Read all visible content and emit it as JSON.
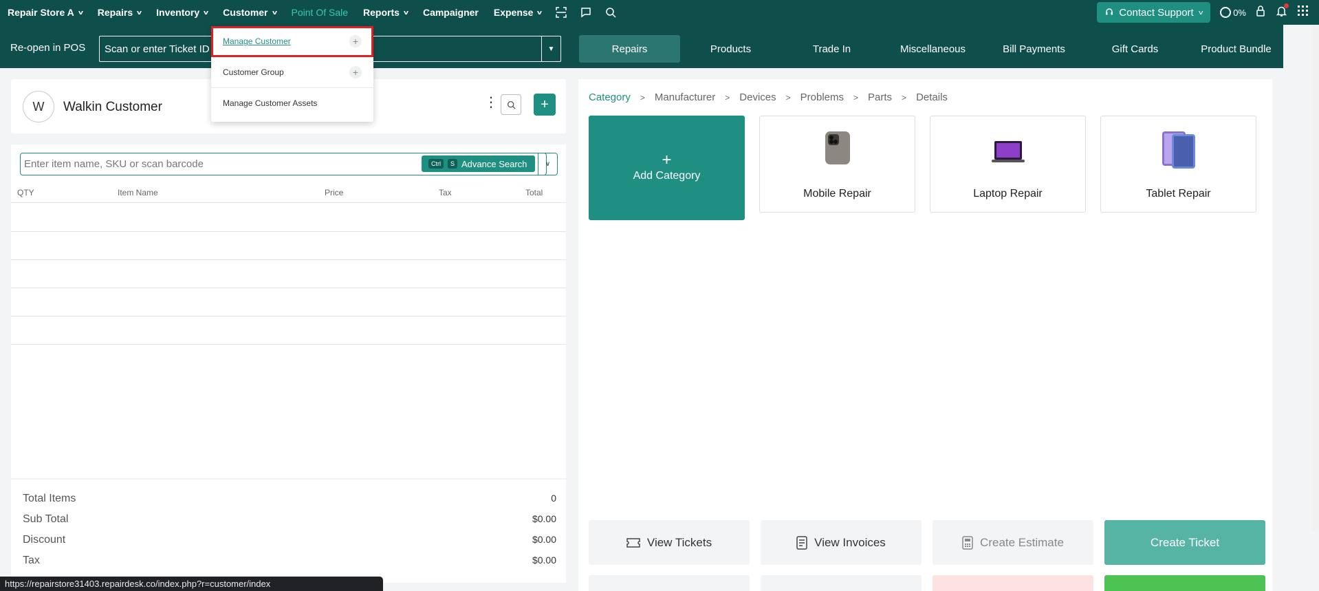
{
  "topnav": {
    "items": [
      {
        "label": "Repair Store A",
        "chevron": true
      },
      {
        "label": "Repairs",
        "chevron": true
      },
      {
        "label": "Inventory",
        "chevron": true
      },
      {
        "label": "Customer",
        "chevron": true
      },
      {
        "label": "Point Of Sale",
        "chevron": false,
        "active": true
      },
      {
        "label": "Reports",
        "chevron": true
      },
      {
        "label": "Campaigner",
        "chevron": false
      },
      {
        "label": "Expense",
        "chevron": true
      }
    ],
    "icons": [
      "scan-icon",
      "chat-icon",
      "search-icon"
    ],
    "contact_support": "Contact Support",
    "progress": "0%"
  },
  "subbar": {
    "reopen_label": "Re-open in POS",
    "ticket_placeholder": "Scan or enter Ticket ID",
    "tabs": [
      "Repairs",
      "Products",
      "Trade In",
      "Miscellaneous",
      "Bill Payments",
      "Gift Cards",
      "Product Bundle"
    ]
  },
  "customer_menu": {
    "items": [
      "Manage Customer",
      "Customer Group",
      "Manage Customer Assets"
    ]
  },
  "customer": {
    "initial": "W",
    "name": "Walkin Customer"
  },
  "cart": {
    "search_placeholder": "Enter item name, SKU or scan barcode",
    "kbd1": "Ctrl",
    "kbd2": "S",
    "advance_search": "Advance Search",
    "columns": [
      "QTY",
      "Item Name",
      "Price",
      "Tax",
      "Total"
    ]
  },
  "totals": {
    "total_items_label": "Total Items",
    "total_items": "0",
    "subtotal_label": "Sub Total",
    "subtotal": "$0.00",
    "discount_label": "Discount",
    "discount": "$0.00",
    "tax_label": "Tax",
    "tax": "$0.00"
  },
  "breadcrumb": [
    "Category",
    "Manufacturer",
    "Devices",
    "Problems",
    "Parts",
    "Details"
  ],
  "tiles": {
    "add": "Add Category",
    "mobile": "Mobile Repair",
    "laptop": "Laptop Repair",
    "tablet": "Tablet Repair"
  },
  "actions": {
    "view_tickets": "View Tickets",
    "view_invoices": "View Invoices",
    "create_estimate": "Create Estimate",
    "create_ticket": "Create Ticket"
  },
  "status_url": "https://repairstore31403.repairdesk.co/index.php?r=customer/index",
  "colors": {
    "nav_bg": "#0f4f4b",
    "accent": "#1f8f82",
    "active_nav": "#35c9b1",
    "highlight": "#e02020"
  }
}
